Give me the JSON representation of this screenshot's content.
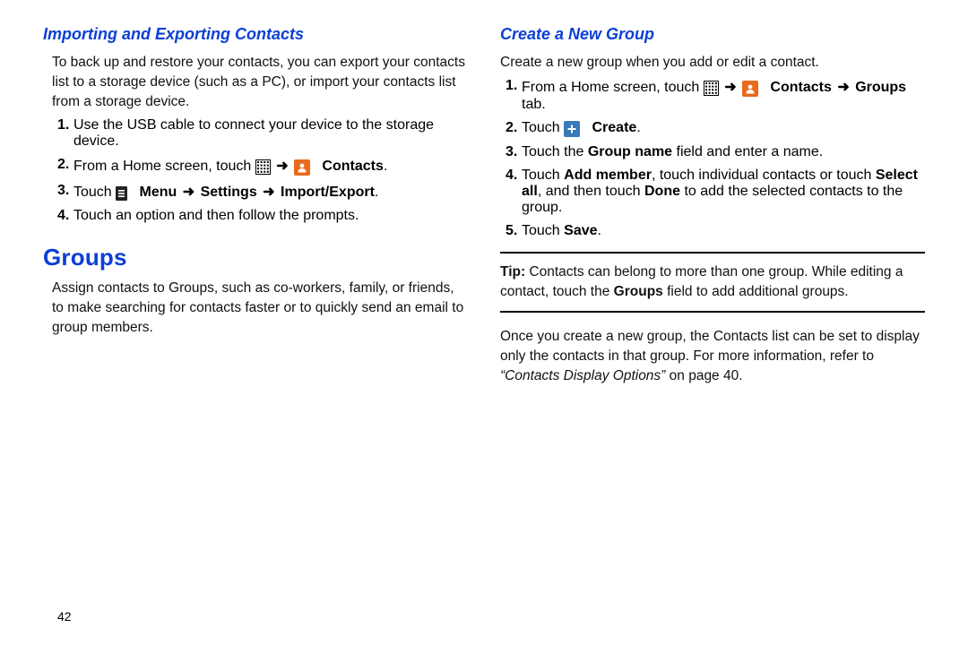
{
  "left": {
    "subhead": "Importing and Exporting Contacts",
    "intro": "To back up and restore your contacts, you can export your contacts list to a storage device (such as a PC), or import your contacts list from a storage device.",
    "steps": {
      "s1": "Use the USB cable to connect your device to the storage device.",
      "s2_a": "From a Home screen, touch ",
      "s2_contacts": "Contacts",
      "s3_a": "Touch ",
      "s3_b": "Menu",
      "s3_c": "Settings",
      "s3_d": "Import/Export",
      "s4": "Touch an option and then follow the prompts."
    },
    "h2": "Groups",
    "groups_body": "Assign contacts to Groups, such as co-workers, family, or friends, to make searching for contacts faster or to quickly send an email to group members."
  },
  "right": {
    "subhead": "Create a New Group",
    "intro": "Create a new group when you add or edit a contact.",
    "steps": {
      "s1_a": "From a Home screen, touch ",
      "s1_contacts": "Contacts",
      "s1_groups": "Groups",
      "s1_tab": " tab.",
      "s2_a": "Touch ",
      "s2_b": "Create",
      "s3_a": "Touch the ",
      "s3_b": "Group name",
      "s3_c": " field and enter a name.",
      "s4_a": "Touch ",
      "s4_b": "Add member",
      "s4_c": ", touch individual contacts or touch ",
      "s4_d": "Select all",
      "s4_e": ", and then touch ",
      "s4_f": "Done",
      "s4_g": " to add the selected contacts to the group.",
      "s5_a": "Touch ",
      "s5_b": "Save"
    },
    "tip_label": "Tip:",
    "tip_a": " Contacts can belong to more than one group. While editing a contact, touch the ",
    "tip_b": "Groups",
    "tip_c": " field to add additional groups.",
    "after_a": "Once you create a new group, the Contacts list can be set to display only the contacts in that group. For more information, refer to ",
    "after_b": "“Contacts Display Options”",
    "after_c": " on page 40."
  },
  "page_number": "42",
  "nums": {
    "n1": "1.",
    "n2": "2.",
    "n3": "3.",
    "n4": "4.",
    "n5": "5."
  },
  "glyphs": {
    "arrow": "➜",
    "period": "."
  }
}
